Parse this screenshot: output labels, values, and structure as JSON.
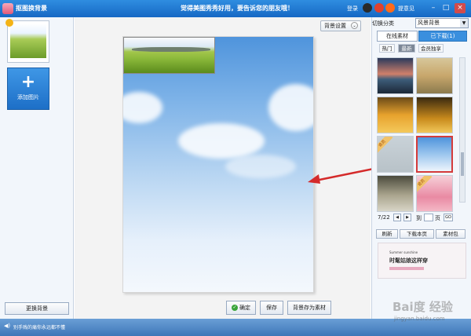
{
  "titlebar": {
    "title": "抠图换背景",
    "slogan": "觉得美图秀秀好用，要告诉您的朋友哦！",
    "login": "登录",
    "feedback": "提意见",
    "minimize": "–",
    "maximize": "□",
    "close": "×"
  },
  "left_panel": {
    "add_image_label": "添加图片",
    "add_image_plus": "+",
    "change_background_label": "更换背景"
  },
  "canvas": {
    "background_settings_label": "背景设置",
    "background_settings_chevron": "⌄",
    "confirm_label": "确定",
    "confirm_icon": "✓",
    "save_label": "保存",
    "save_as_material_label": "背景存为素材"
  },
  "right_panel": {
    "switch_category_label": "切换分类",
    "category_selected": "风景背景",
    "category_dropdown_icon": "▼",
    "tabs": [
      "在线素材",
      "已下载(1)"
    ],
    "sub_tabs": [
      "热门",
      "最新",
      "会员独享"
    ],
    "thumbnails": [
      {
        "tag": ""
      },
      {
        "tag": ""
      },
      {
        "tag": ""
      },
      {
        "tag": ""
      },
      {
        "tag": "会员"
      },
      {
        "tag": ""
      },
      {
        "tag": ""
      },
      {
        "tag": "会员"
      }
    ],
    "pager": {
      "current": "7/22",
      "prev": "◀",
      "next": "▶",
      "goto_label": "到",
      "page_unit": "页",
      "go_label": "GO"
    },
    "actions": [
      "刷新",
      "下载本页",
      "素材包"
    ],
    "ad": {
      "small_text": "Summer sunshine",
      "headline": "时髦姑娘这样穿"
    }
  },
  "statusbar": {
    "message": "别手贱的痛你永远都不懂"
  },
  "watermark": {
    "text": "Bai度 经验",
    "url": "jingyan.baidu.com"
  },
  "colors": {
    "titlebar": "#1668c4",
    "accent": "#3a8fde",
    "selection_border": "#d43b3b",
    "arrow": "#d42a2a"
  }
}
